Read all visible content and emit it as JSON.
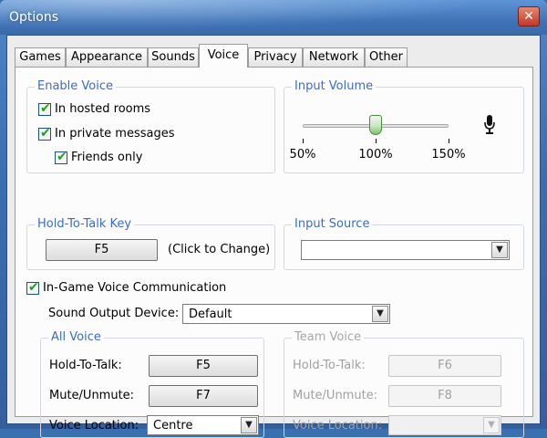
{
  "window": {
    "title": "Options",
    "close_glyph": "✕"
  },
  "tabs": [
    {
      "label": "Games",
      "active": false
    },
    {
      "label": "Appearance",
      "active": false
    },
    {
      "label": "Sounds",
      "active": false
    },
    {
      "label": "Voice",
      "active": true
    },
    {
      "label": "Privacy",
      "active": false
    },
    {
      "label": "Network",
      "active": false
    },
    {
      "label": "Other",
      "active": false
    }
  ],
  "enable_voice": {
    "legend": "Enable Voice",
    "hosted_rooms": {
      "label": "In hosted rooms",
      "checked": true
    },
    "private_messages": {
      "label": "In private messages",
      "checked": true
    },
    "friends_only": {
      "label": "Friends only",
      "checked": true
    }
  },
  "input_volume": {
    "legend": "Input Volume",
    "value_percent": 100,
    "min_percent": 50,
    "max_percent": 150,
    "tick_labels": [
      "50%",
      "100%",
      "150%"
    ],
    "icon": "microphone-icon"
  },
  "hold_to_talk_key": {
    "legend": "Hold-To-Talk Key",
    "key": "F5",
    "hint": "(Click to Change)"
  },
  "input_source": {
    "legend": "Input Source",
    "selected": ""
  },
  "in_game_voice": {
    "label": "In-Game Voice Communication",
    "checked": true,
    "sound_output_label": "Sound Output Device:",
    "sound_output_value": "Default"
  },
  "all_voice": {
    "legend": "All Voice",
    "hold_to_talk_label": "Hold-To-Talk:",
    "hold_to_talk_key": "F5",
    "mute_label": "Mute/Unmute:",
    "mute_key": "F7",
    "location_label": "Voice Location:",
    "location_value": "Centre"
  },
  "team_voice": {
    "legend": "Team Voice",
    "hold_to_talk_label": "Hold-To-Talk:",
    "hold_to_talk_key": "F6",
    "mute_label": "Mute/Unmute:",
    "mute_key": "F8",
    "location_label": "Voice Location:",
    "location_value": ""
  },
  "colors": {
    "legend": "#3b6cc9",
    "check": "#21a121",
    "disabled_text": "#a0a0a0",
    "title_bar": "#3f74b8"
  }
}
